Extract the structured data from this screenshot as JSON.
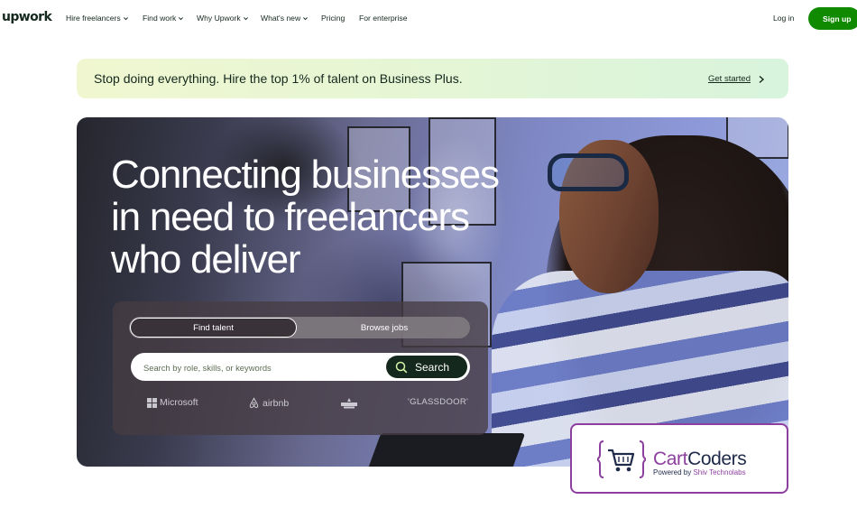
{
  "brand": {
    "logo_text": "upwork"
  },
  "nav": {
    "items": [
      {
        "label": "Hire freelancers",
        "dropdown": true
      },
      {
        "label": "Find work",
        "dropdown": true
      },
      {
        "label": "Why Upwork",
        "dropdown": true
      },
      {
        "label": "What's new",
        "dropdown": true
      },
      {
        "label": "Pricing",
        "dropdown": false
      },
      {
        "label": "For enterprise",
        "dropdown": false
      }
    ],
    "login_label": "Log in",
    "signup_label": "Sign up"
  },
  "promo": {
    "text": "Stop doing everything. Hire the top 1% of talent on Business Plus.",
    "cta_label": "Get started"
  },
  "hero": {
    "title_lines": [
      "Connecting businesses",
      "in need to freelancers",
      "who deliver"
    ],
    "tabs": {
      "active": "Find talent",
      "inactive": "Browse jobs"
    },
    "search": {
      "placeholder": "Search by role, skills, or keywords",
      "button_label": "Search"
    },
    "trusted_by": [
      "Microsoft",
      "airbnb",
      "",
      "GLASSDOOR"
    ]
  },
  "watermark": {
    "brand_part1": "Cart",
    "brand_part2": "Coders",
    "sub_prefix": "Powered by ",
    "sub_company": "Shiv Technolabs"
  },
  "colors": {
    "accent": "#108a00",
    "dark": "#14281d",
    "watermark": "#8d3f9f"
  }
}
